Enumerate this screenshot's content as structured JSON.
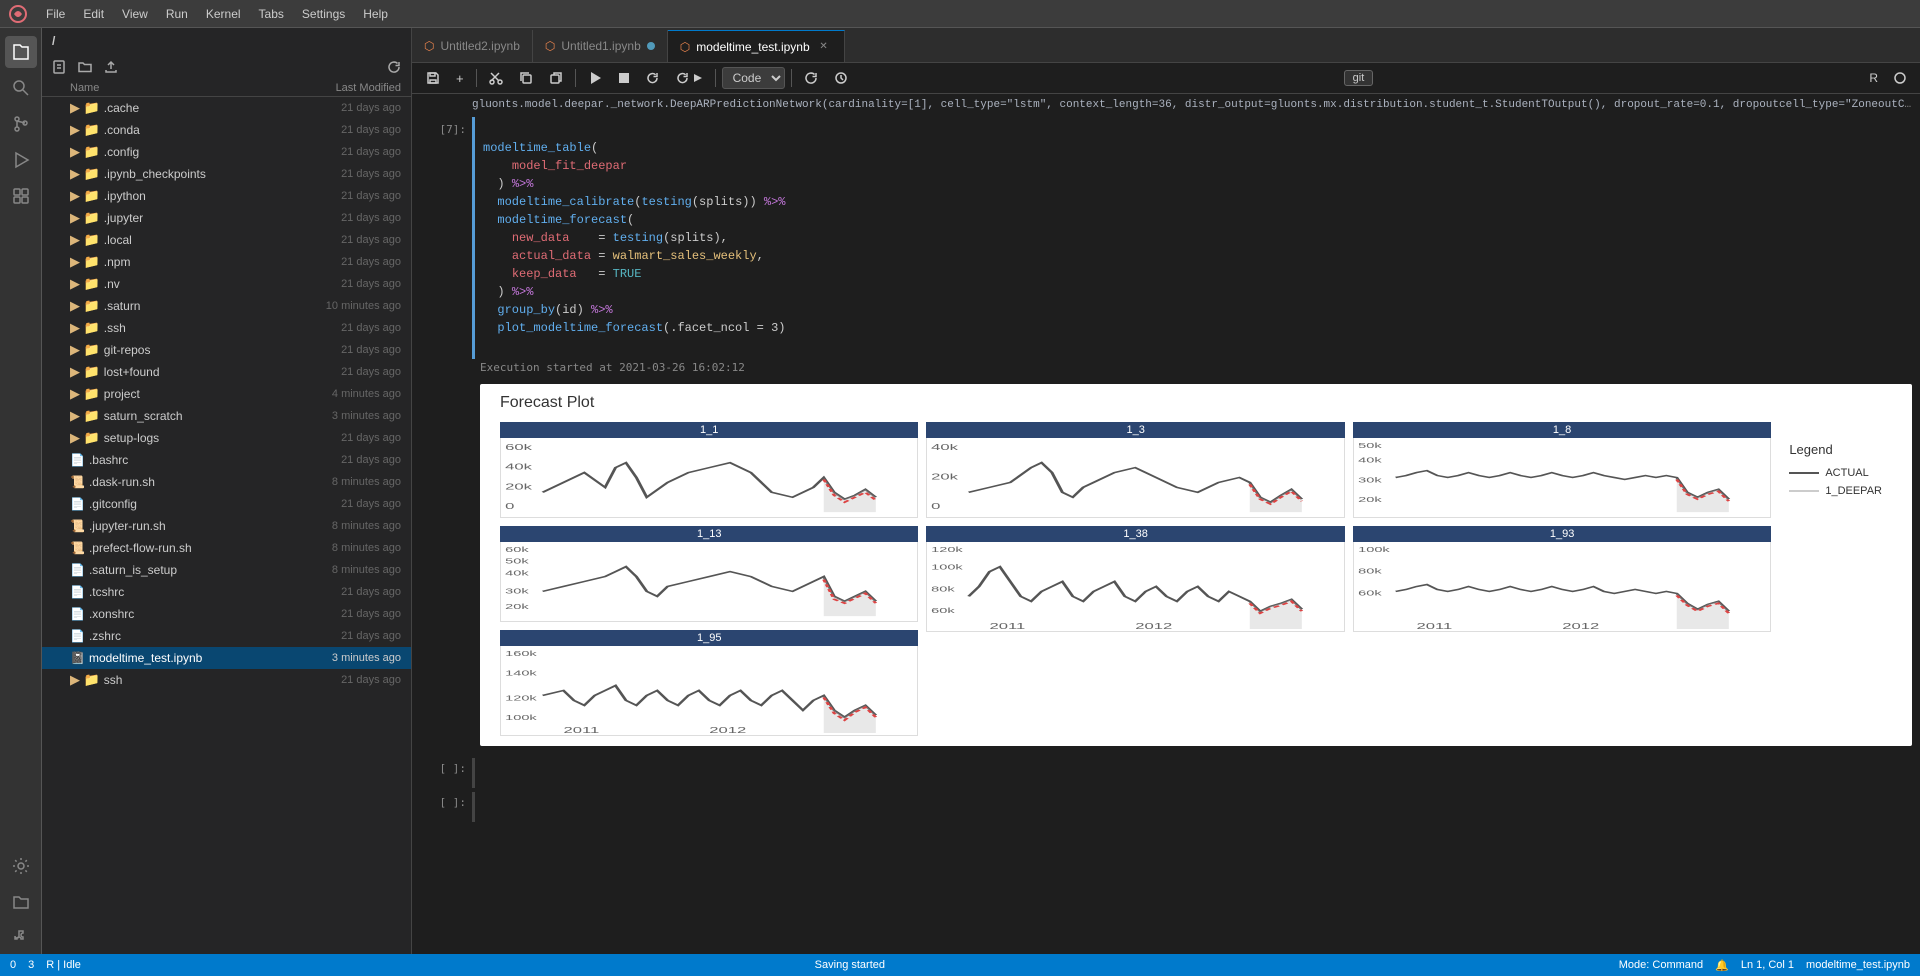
{
  "menubar": {
    "items": [
      "File",
      "Edit",
      "View",
      "Run",
      "Kernel",
      "Tabs",
      "Settings",
      "Help"
    ]
  },
  "sidebar": {
    "header": "Name",
    "modified_header": "Last Modified",
    "current_path": "/",
    "files": [
      {
        "name": ".cache",
        "modified": "21 days ago",
        "type": "folder",
        "selected": false
      },
      {
        "name": ".conda",
        "modified": "21 days ago",
        "type": "folder",
        "selected": false
      },
      {
        "name": ".config",
        "modified": "21 days ago",
        "type": "folder",
        "selected": false
      },
      {
        "name": ".ipynb_checkpoints",
        "modified": "21 days ago",
        "type": "folder",
        "selected": false
      },
      {
        "name": ".ipython",
        "modified": "21 days ago",
        "type": "folder",
        "selected": false
      },
      {
        "name": ".jupyter",
        "modified": "21 days ago",
        "type": "folder",
        "selected": false
      },
      {
        "name": ".local",
        "modified": "21 days ago",
        "type": "folder",
        "selected": false
      },
      {
        "name": ".npm",
        "modified": "21 days ago",
        "type": "folder",
        "selected": false
      },
      {
        "name": ".nv",
        "modified": "21 days ago",
        "type": "folder",
        "selected": false
      },
      {
        "name": ".saturn",
        "modified": "10 minutes ago",
        "type": "folder",
        "selected": false
      },
      {
        "name": ".ssh",
        "modified": "21 days ago",
        "type": "folder",
        "selected": false
      },
      {
        "name": "git-repos",
        "modified": "21 days ago",
        "type": "folder",
        "selected": false
      },
      {
        "name": "lost+found",
        "modified": "21 days ago",
        "type": "folder",
        "selected": false
      },
      {
        "name": "project",
        "modified": "4 minutes ago",
        "type": "folder",
        "selected": false
      },
      {
        "name": "saturn_scratch",
        "modified": "3 minutes ago",
        "type": "folder",
        "selected": false
      },
      {
        "name": "setup-logs",
        "modified": "21 days ago",
        "type": "folder",
        "selected": false
      },
      {
        "name": ".bashrc",
        "modified": "21 days ago",
        "type": "file",
        "selected": false
      },
      {
        "name": ".dask-run.sh",
        "modified": "8 minutes ago",
        "type": "script",
        "selected": false
      },
      {
        "name": ".gitconfig",
        "modified": "21 days ago",
        "type": "file",
        "selected": false
      },
      {
        "name": ".jupyter-run.sh",
        "modified": "8 minutes ago",
        "type": "script",
        "selected": false
      },
      {
        "name": ".prefect-flow-run.sh",
        "modified": "8 minutes ago",
        "type": "script",
        "selected": false
      },
      {
        "name": ".saturn_is_setup",
        "modified": "8 minutes ago",
        "type": "file",
        "selected": false
      },
      {
        "name": ".tcshrc",
        "modified": "21 days ago",
        "type": "file",
        "selected": false
      },
      {
        "name": ".xonshrc",
        "modified": "21 days ago",
        "type": "file",
        "selected": false
      },
      {
        "name": ".zshrc",
        "modified": "21 days ago",
        "type": "file",
        "selected": false
      },
      {
        "name": "modeltime_test.ipynb",
        "modified": "3 minutes ago",
        "type": "notebook",
        "selected": true
      },
      {
        "name": "ssh",
        "modified": "21 days ago",
        "type": "folder",
        "selected": false
      }
    ]
  },
  "tabs": [
    {
      "label": "Untitled2.ipynb",
      "active": false,
      "type": "notebook"
    },
    {
      "label": "Untitled1.ipynb",
      "active": false,
      "type": "notebook",
      "dot": true
    },
    {
      "label": "modeltime_test.ipynb",
      "active": true,
      "type": "notebook",
      "closeable": true
    }
  ],
  "notebook": {
    "toolbar": {
      "save": "💾",
      "add": "+",
      "cut": "✂",
      "copy": "⎘",
      "paste": "⎗",
      "run": "▶",
      "stop": "■",
      "restart": "↺",
      "fast_forward": "⏭",
      "cell_type": "Code",
      "git_label": "git"
    },
    "cell7": {
      "label": "[7]:",
      "code": "modeltime_table(\n    model_fit_deepar\n  ) %>%\n  modeltime_calibrate(testing(splits)) %>%\n  modeltime_forecast(\n    new_data    = testing(splits),\n    actual_data = walmart_sales_weekly,\n    keep_data   = TRUE\n  ) %>%\n  group_by(id) %>%\n  plot_modeltime_forecast(.facet_ncol = 3)"
    },
    "execution_time": "Execution started at 2021-03-26 16:02:12",
    "forecast_plot": {
      "title": "Forecast Plot",
      "charts": [
        {
          "id": "1_1",
          "col": 0,
          "row": 0
        },
        {
          "id": "1_13",
          "col": 0,
          "row": 1
        },
        {
          "id": "1_95",
          "col": 0,
          "row": 2
        },
        {
          "id": "1_3",
          "col": 1,
          "row": 0
        },
        {
          "id": "1_38",
          "col": 1,
          "row": 1
        },
        {
          "id": "1_8",
          "col": 2,
          "row": 0
        },
        {
          "id": "1_93",
          "col": 2,
          "row": 1
        }
      ],
      "x_labels_bottom": [
        "2011",
        "2012"
      ],
      "legend": {
        "title": "Legend",
        "items": [
          {
            "label": "ACTUAL",
            "style": "solid",
            "color": "#555"
          },
          {
            "label": "1_DEEPAR",
            "style": "dashed",
            "color": "#ccc"
          }
        ]
      }
    }
  },
  "statusbar": {
    "left": [
      "0",
      "3",
      "R | Idle"
    ],
    "center": "Saving started",
    "right": [
      "Mode: Command",
      "Ln 1, Col 1",
      "modeltime_test.ipynb"
    ]
  },
  "icons": {
    "folder": "📁",
    "file": "📄",
    "notebook": "📓",
    "script": "📜"
  }
}
